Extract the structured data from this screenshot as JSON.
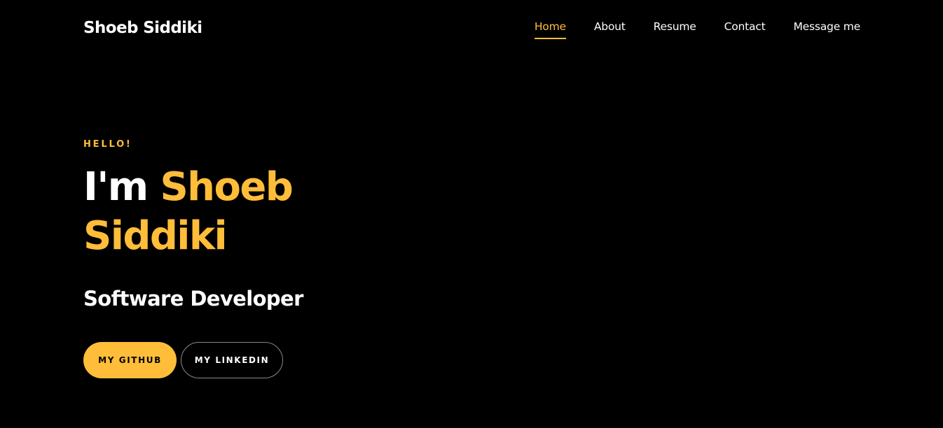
{
  "colors": {
    "background": "#000000",
    "accent": "#ffbd39",
    "text": "#ffffff"
  },
  "navbar": {
    "brand": "Shoeb Siddiki",
    "links": [
      {
        "label": "Home",
        "active": true
      },
      {
        "label": "About",
        "active": false
      },
      {
        "label": "Resume",
        "active": false
      },
      {
        "label": "Contact",
        "active": false
      },
      {
        "label": "Message me",
        "active": false
      }
    ]
  },
  "hero": {
    "greeting": "HELLO!",
    "intro": "I'm",
    "name": "Shoeb Siddiki",
    "role": "Software Developer",
    "buttons": {
      "github": "MY GITHUB",
      "linkedin": "MY LINKEDIN"
    }
  }
}
